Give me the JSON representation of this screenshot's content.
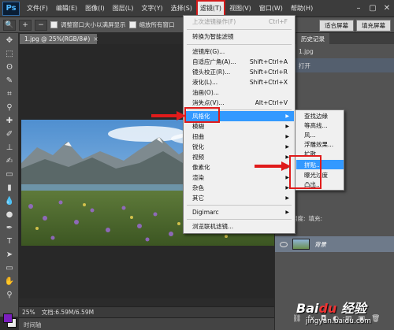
{
  "app": {
    "logo": "Ps"
  },
  "menubar": {
    "items": [
      "文件(F)",
      "编辑(E)",
      "图像(I)",
      "图层(L)",
      "文字(Y)",
      "选择(S)",
      "滤镜(T)",
      "视图(V)",
      "窗口(W)",
      "帮助(H)"
    ],
    "active_index": 6,
    "window_controls": [
      "–",
      "▢",
      "✕"
    ]
  },
  "options_bar": {
    "checkbox1_label": "调整窗口大小以满屏显示",
    "checkbox2_label": "缩放所有窗口",
    "right_buttons": [
      "适合屏幕",
      "填充屏幕"
    ]
  },
  "document": {
    "tab_title": "1.jpg @ 25%(RGB/8#)",
    "tab_close": "×",
    "zoom": "25%",
    "doc_size": "文档:6.59M/6.59M",
    "timeline": "时间轴"
  },
  "history_panel": {
    "tabs": [
      "画板",
      "历史记录"
    ],
    "rows": [
      "1.jpg",
      "打开"
    ]
  },
  "layers_panel": {
    "opacity_label": "不透明度:",
    "fill_label": "填充:",
    "layer_name": "背景"
  },
  "filter_menu": {
    "items": [
      {
        "label": "上次滤镜操作(F)",
        "shortcut": "Ctrl+F",
        "disabled": true
      },
      {
        "label": "转换为智能滤镜"
      },
      {
        "label": "滤镜库(G)..."
      },
      {
        "label": "自适应广角(A)...",
        "shortcut": "Shift+Ctrl+A"
      },
      {
        "label": "镜头校正(R)...",
        "shortcut": "Shift+Ctrl+R"
      },
      {
        "label": "液化(L)...",
        "shortcut": "Shift+Ctrl+X"
      },
      {
        "label": "油画(O)..."
      },
      {
        "label": "消失点(V)...",
        "shortcut": "Alt+Ctrl+V"
      },
      {
        "label": "风格化",
        "submenu": true,
        "hover": true
      },
      {
        "label": "模糊",
        "submenu": true
      },
      {
        "label": "扭曲",
        "submenu": true
      },
      {
        "label": "锐化",
        "submenu": true
      },
      {
        "label": "视频",
        "submenu": true
      },
      {
        "label": "像素化",
        "submenu": true
      },
      {
        "label": "渲染",
        "submenu": true
      },
      {
        "label": "杂色",
        "submenu": true
      },
      {
        "label": "其它",
        "submenu": true
      },
      {
        "label": "Digimarc",
        "submenu": true
      },
      {
        "label": "浏览联机滤镜..."
      }
    ]
  },
  "stylize_submenu": {
    "items": [
      "查找边缘",
      "等高线...",
      "风...",
      "浮雕效果...",
      "扩散...",
      "拼贴...",
      "曝光过度",
      "凸出..."
    ],
    "hover_index": 5
  },
  "watermark": {
    "url": "jingyan.baidu.com"
  },
  "colors": {
    "foreground": "#7b1fbf",
    "background": "#ececec",
    "highlight": "#3399ff",
    "annotation_red": "#e01b1b"
  }
}
